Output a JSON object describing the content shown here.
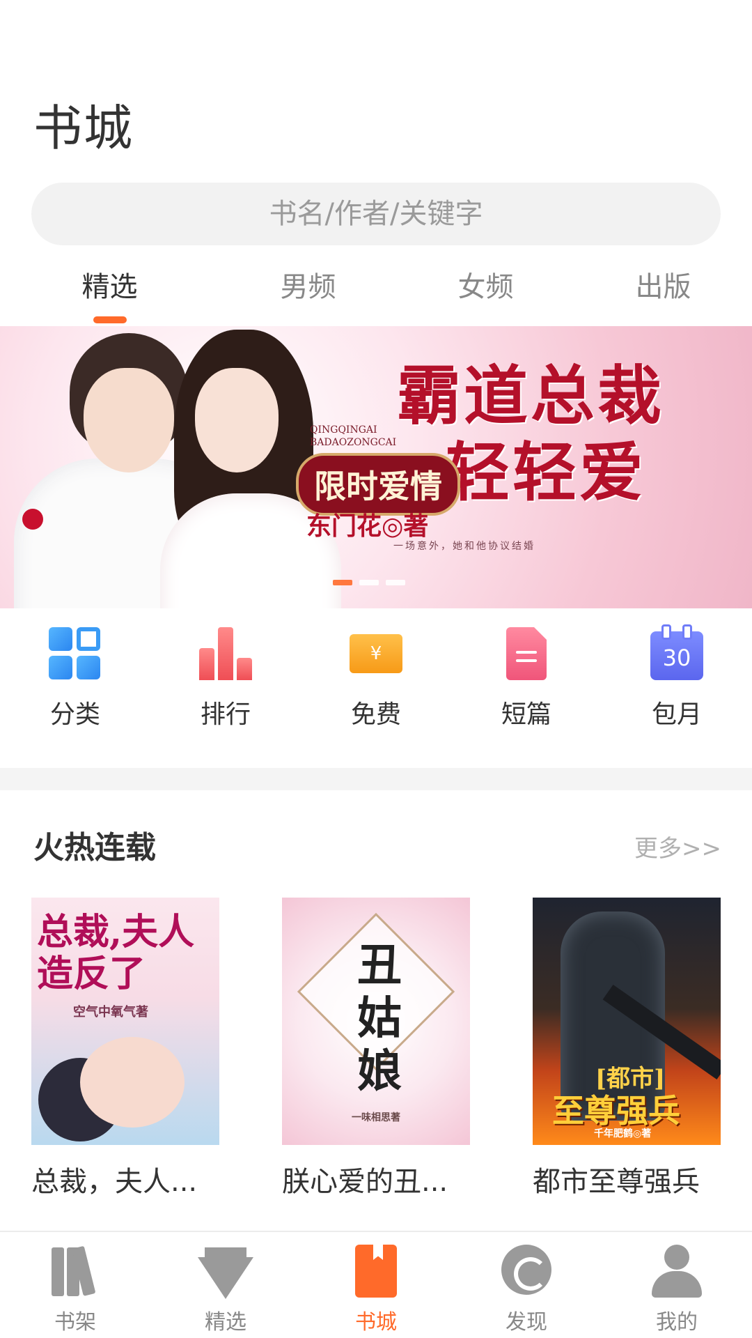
{
  "header": {
    "title": "书城"
  },
  "search": {
    "placeholder": "书名/作者/关键字"
  },
  "tabs": [
    {
      "label": "精选",
      "active": true
    },
    {
      "label": "男频",
      "active": false
    },
    {
      "label": "女频",
      "active": false
    },
    {
      "label": "出版",
      "active": false
    }
  ],
  "banner": {
    "title_line1": "霸道总裁",
    "title_line2": "轻轻爱",
    "subtitle": "限时爱情",
    "pinyin_line1": "QINGQINGAI",
    "pinyin_line2": "BADAOZONGCAI",
    "author": "东门花◎著",
    "tagline": "一场意外，她和他协议结婚",
    "dots": [
      true,
      false,
      false
    ]
  },
  "quick_links": [
    {
      "label": "分类",
      "icon": "category-grid-icon"
    },
    {
      "label": "排行",
      "icon": "ranking-bars-icon"
    },
    {
      "label": "免费",
      "icon": "free-ticket-icon",
      "glyph": "¥"
    },
    {
      "label": "短篇",
      "icon": "short-story-doc-icon"
    },
    {
      "label": "包月",
      "icon": "monthly-calendar-icon",
      "glyph": "30"
    }
  ],
  "section": {
    "title": "火热连载",
    "more": "更多>>"
  },
  "books": [
    {
      "title": "总裁，夫人...",
      "cover_title": "总裁,夫人造反了",
      "cover_author": "空气中氧气著"
    },
    {
      "title": "朕心爱的丑...",
      "cover_title": "丑姑娘",
      "cover_author": "一味相思著"
    },
    {
      "title": "都市至尊强兵",
      "cover_tag": "[都市]",
      "cover_title": "至尊强兵",
      "cover_author": "千年肥鹤◎著"
    }
  ],
  "bottom_nav": [
    {
      "label": "书架",
      "icon": "bookshelf-icon",
      "active": false
    },
    {
      "label": "精选",
      "icon": "diamond-icon",
      "active": false
    },
    {
      "label": "书城",
      "icon": "bookstore-icon",
      "active": true
    },
    {
      "label": "发现",
      "icon": "discover-icon",
      "active": false
    },
    {
      "label": "我的",
      "icon": "profile-icon",
      "active": false
    }
  ],
  "colors": {
    "accent": "#ff6a2a",
    "text": "#333333",
    "muted": "#888888"
  }
}
